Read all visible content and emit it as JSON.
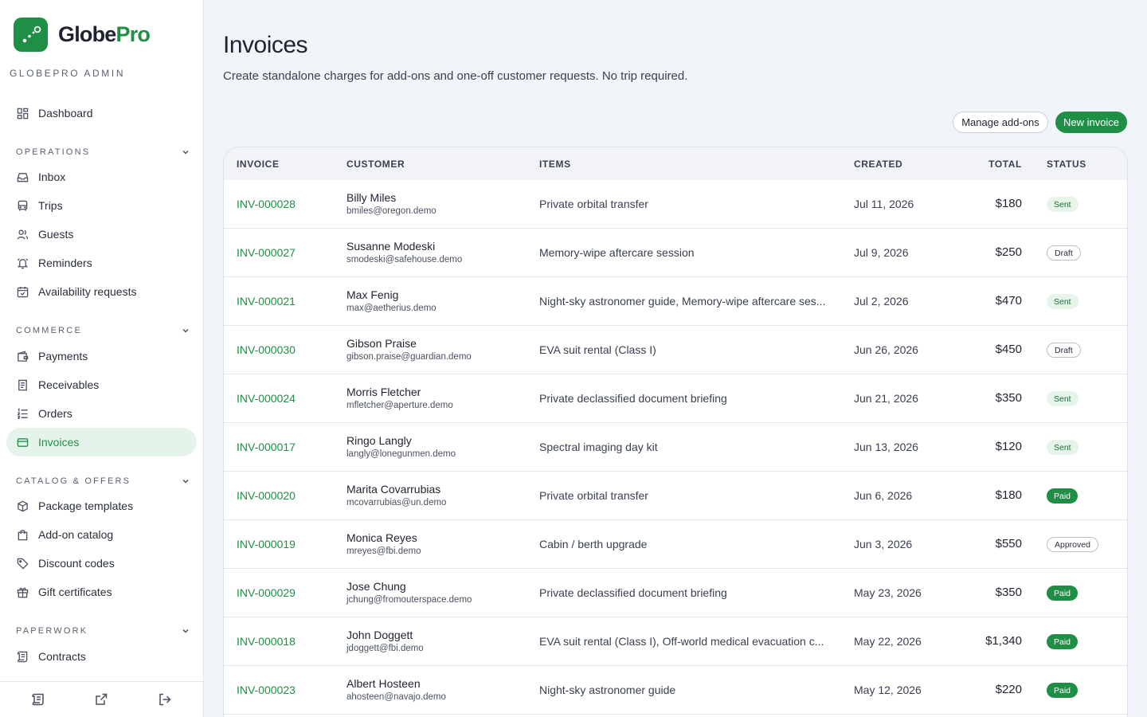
{
  "brand": {
    "name_main": "Globe",
    "name_accent": "Pro",
    "admin_label": "GLOBEPRO ADMIN"
  },
  "nav": {
    "dashboard": "Dashboard",
    "sections": {
      "operations": "OPERATIONS",
      "commerce": "COMMERCE",
      "catalog": "CATALOG & OFFERS",
      "paperwork": "PAPERWORK"
    },
    "operations": [
      "Inbox",
      "Trips",
      "Guests",
      "Reminders",
      "Availability requests"
    ],
    "commerce": [
      "Payments",
      "Receivables",
      "Orders",
      "Invoices"
    ],
    "catalog": [
      "Package templates",
      "Add-on catalog",
      "Discount codes",
      "Gift certificates"
    ],
    "paperwork": [
      "Contracts"
    ],
    "active": "Invoices"
  },
  "page": {
    "title": "Invoices",
    "subtitle": "Create standalone charges for add-ons and one-off customer requests. No trip required."
  },
  "actions": {
    "manage_addons": "Manage add-ons",
    "new_invoice": "New invoice"
  },
  "table": {
    "columns": {
      "invoice": "INVOICE",
      "customer": "CUSTOMER",
      "items": "ITEMS",
      "created": "CREATED",
      "total": "TOTAL",
      "status": "STATUS"
    },
    "rows": [
      {
        "id": "INV-000028",
        "name": "Billy Miles",
        "email": "bmiles@oregon.demo",
        "items": "Private orbital transfer",
        "created": "Jul 11, 2026",
        "total": "$180",
        "status": "Sent"
      },
      {
        "id": "INV-000027",
        "name": "Susanne Modeski",
        "email": "smodeski@safehouse.demo",
        "items": "Memory-wipe aftercare session",
        "created": "Jul 9, 2026",
        "total": "$250",
        "status": "Draft"
      },
      {
        "id": "INV-000021",
        "name": "Max Fenig",
        "email": "max@aetherius.demo",
        "items": "Night-sky astronomer guide, Memory-wipe aftercare ses...",
        "created": "Jul 2, 2026",
        "total": "$470",
        "status": "Sent"
      },
      {
        "id": "INV-000030",
        "name": "Gibson Praise",
        "email": "gibson.praise@guardian.demo",
        "items": "EVA suit rental (Class I)",
        "created": "Jun 26, 2026",
        "total": "$450",
        "status": "Draft"
      },
      {
        "id": "INV-000024",
        "name": "Morris Fletcher",
        "email": "mfletcher@aperture.demo",
        "items": "Private declassified document briefing",
        "created": "Jun 21, 2026",
        "total": "$350",
        "status": "Sent"
      },
      {
        "id": "INV-000017",
        "name": "Ringo Langly",
        "email": "langly@lonegunmen.demo",
        "items": "Spectral imaging day kit",
        "created": "Jun 13, 2026",
        "total": "$120",
        "status": "Sent"
      },
      {
        "id": "INV-000020",
        "name": "Marita Covarrubias",
        "email": "mcovarrubias@un.demo",
        "items": "Private orbital transfer",
        "created": "Jun 6, 2026",
        "total": "$180",
        "status": "Paid"
      },
      {
        "id": "INV-000019",
        "name": "Monica Reyes",
        "email": "mreyes@fbi.demo",
        "items": "Cabin / berth upgrade",
        "created": "Jun 3, 2026",
        "total": "$550",
        "status": "Approved"
      },
      {
        "id": "INV-000029",
        "name": "Jose Chung",
        "email": "jchung@fromouterspace.demo",
        "items": "Private declassified document briefing",
        "created": "May 23, 2026",
        "total": "$350",
        "status": "Paid"
      },
      {
        "id": "INV-000018",
        "name": "John Doggett",
        "email": "jdoggett@fbi.demo",
        "items": "EVA suit rental (Class I), Off-world medical evacuation c...",
        "created": "May 22, 2026",
        "total": "$1,340",
        "status": "Paid"
      },
      {
        "id": "INV-000023",
        "name": "Albert Hosteen",
        "email": "ahosteen@navajo.demo",
        "items": "Night-sky astronomer guide",
        "created": "May 12, 2026",
        "total": "$220",
        "status": "Paid"
      }
    ]
  },
  "colors": {
    "accent": "#1f8f45",
    "active_bg": "#e4f4ea",
    "page_bg": "#f1f4f9"
  }
}
